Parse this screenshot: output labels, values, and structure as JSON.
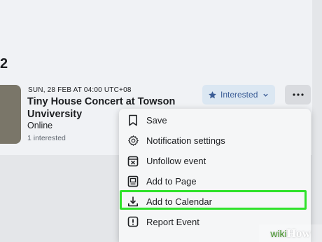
{
  "section": {
    "number": "2"
  },
  "event": {
    "date": "SUN, 28 FEB AT 04:00 UTC+08",
    "title": "Tiny House Concert at Towson Unviversity",
    "location": "Online",
    "attendees": "1 interested"
  },
  "actions": {
    "interested_label": "Interested",
    "more_label": "···"
  },
  "menu": {
    "items": [
      {
        "label": "Save",
        "icon": "bookmark-icon"
      },
      {
        "label": "Notification settings",
        "icon": "gear-icon"
      },
      {
        "label": "Unfollow event",
        "icon": "unfollow-calendar-icon"
      },
      {
        "label": "Add to Page",
        "icon": "page-icon"
      },
      {
        "label": "Add to Calendar",
        "icon": "download-icon",
        "highlighted": true
      },
      {
        "label": "Report Event",
        "icon": "report-icon"
      }
    ]
  },
  "watermark": {
    "prefix": "wiki",
    "suffix": "How"
  },
  "colors": {
    "accent": "#3b5d96",
    "interested_bg": "#dbe7f2",
    "highlight": "#2fe22a",
    "page_bg": "#e4e6e9",
    "card_bg": "#f0f2f5"
  }
}
